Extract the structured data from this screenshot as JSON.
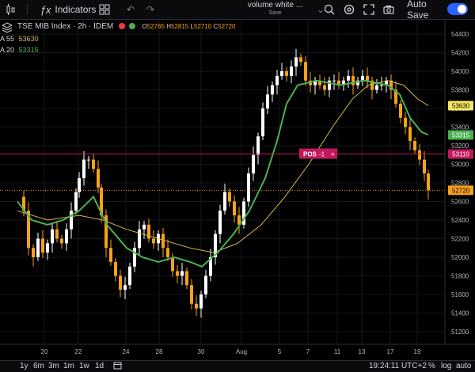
{
  "toolbar": {
    "indicators_label": "Indicators",
    "layout_title": "volume white ...",
    "layout_status": "Save",
    "autosave_label": "Auto Save",
    "icons": [
      "chart-type-icon",
      "function-icon",
      "layout-grid-icon",
      "undo-icon",
      "redo-icon",
      "search-icon",
      "settings-icon",
      "fullscreen-icon",
      "camera-icon"
    ]
  },
  "legend": {
    "symbol": "TSE MIB Index · 2h · IDEM",
    "open_label": "O",
    "open": "52765",
    "high_label": "H",
    "high": "52815",
    "low_label": "L",
    "low": "52710",
    "close_label": "C",
    "close": "52720",
    "ma1_label": "A 55",
    "ma1_value": "53630",
    "ma2_label": "A 20",
    "ma2_value": "53315"
  },
  "colors": {
    "bg": "#000000",
    "up": "#ffffff",
    "down": "#f7a21b",
    "ma_slow": "#d4b84a",
    "ma_fast": "#4caf50",
    "position": "#c2185b",
    "accent": "#2962ff"
  },
  "position": {
    "label": "POS",
    "qty": "-1",
    "price": "53110"
  },
  "price_tags": {
    "ma_slow": "53630",
    "ma_fast": "53315",
    "last": "52720"
  },
  "y_axis": {
    "labels": [
      "54400",
      "54200",
      "54000",
      "53800",
      "53600",
      "53400",
      "53200",
      "53000",
      "52800",
      "52600",
      "52400",
      "52200",
      "52000",
      "51800",
      "51600",
      "51400",
      "51200"
    ],
    "min": 51100,
    "max": 54500
  },
  "x_axis": {
    "labels": [
      "20",
      "22",
      "24",
      "28",
      "30",
      "Aug",
      "5",
      "7",
      "11",
      "13",
      "17",
      "19"
    ]
  },
  "bottom": {
    "ranges": [
      "1y",
      "6m",
      "3m",
      "1m",
      "1w",
      "1d"
    ],
    "time": "19:24:11 UTC+2",
    "percent": "%",
    "log": "log",
    "auto": "auto"
  }
}
